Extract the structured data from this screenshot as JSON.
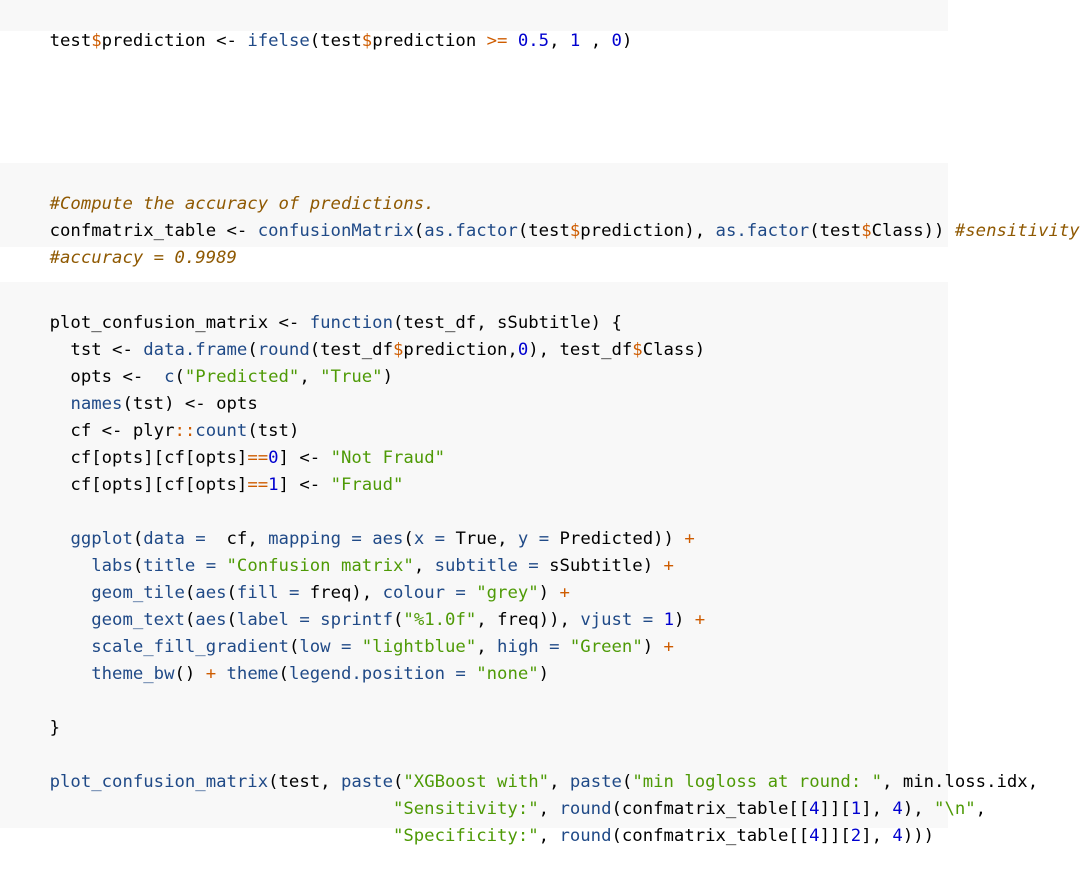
{
  "chunks": [
    {
      "lines": [
        [
          [
            "test",
            "default"
          ],
          [
            "$",
            "op"
          ],
          [
            "prediction <- ",
            "default"
          ],
          [
            "ifelse",
            "fn"
          ],
          [
            "(test",
            "default"
          ],
          [
            "$",
            "op"
          ],
          [
            "prediction ",
            "default"
          ],
          [
            ">=",
            "op"
          ],
          [
            " ",
            "default"
          ],
          [
            "0.5",
            "num"
          ],
          [
            ", ",
            "default"
          ],
          [
            "1",
            "num"
          ],
          [
            " , ",
            "default"
          ],
          [
            "0",
            "num"
          ],
          [
            ")",
            "default"
          ]
        ]
      ]
    },
    {
      "lines": [
        [
          [
            "#Compute the accuracy of predictions.",
            "comment"
          ]
        ],
        [
          [
            "confmatrix_table <- ",
            "default"
          ],
          [
            "confusionMatrix",
            "fn"
          ],
          [
            "(",
            "default"
          ],
          [
            "as.factor",
            "fn"
          ],
          [
            "(test",
            "default"
          ],
          [
            "$",
            "op"
          ],
          [
            "prediction), ",
            "default"
          ],
          [
            "as.factor",
            "fn"
          ],
          [
            "(test",
            "default"
          ],
          [
            "$",
            "op"
          ],
          [
            "Class)) ",
            "default"
          ],
          [
            "#sensitivity",
            "comment"
          ]
        ],
        [
          [
            "#accuracy = 0.9989",
            "comment"
          ]
        ]
      ]
    },
    {
      "lines": [
        [
          [
            "plot_confusion_matrix <- ",
            "default"
          ],
          [
            "function",
            "kw"
          ],
          [
            "(test_df, sSubtitle) {",
            "default"
          ]
        ],
        [
          [
            "  tst <- ",
            "default"
          ],
          [
            "data.frame",
            "fn"
          ],
          [
            "(",
            "default"
          ],
          [
            "round",
            "fn"
          ],
          [
            "(test_df",
            "default"
          ],
          [
            "$",
            "op"
          ],
          [
            "prediction,",
            "default"
          ],
          [
            "0",
            "num"
          ],
          [
            "), test_df",
            "default"
          ],
          [
            "$",
            "op"
          ],
          [
            "Class)",
            "default"
          ]
        ],
        [
          [
            "  opts <-  ",
            "default"
          ],
          [
            "c",
            "fn"
          ],
          [
            "(",
            "default"
          ],
          [
            "\"Predicted\"",
            "str"
          ],
          [
            ", ",
            "default"
          ],
          [
            "\"True\"",
            "str"
          ],
          [
            ")",
            "default"
          ]
        ],
        [
          [
            "  ",
            "default"
          ],
          [
            "names",
            "fn"
          ],
          [
            "(tst) <- opts",
            "default"
          ]
        ],
        [
          [
            "  cf <- plyr",
            "default"
          ],
          [
            "::",
            "op"
          ],
          [
            "count",
            "fn"
          ],
          [
            "(tst)",
            "default"
          ]
        ],
        [
          [
            "  cf[opts][cf[opts]",
            "default"
          ],
          [
            "==",
            "op"
          ],
          [
            "0",
            "num"
          ],
          [
            "] <- ",
            "default"
          ],
          [
            "\"Not Fraud\"",
            "str"
          ]
        ],
        [
          [
            "  cf[opts][cf[opts]",
            "default"
          ],
          [
            "==",
            "op"
          ],
          [
            "1",
            "num"
          ],
          [
            "] <- ",
            "default"
          ],
          [
            "\"Fraud\"",
            "str"
          ]
        ],
        [
          [
            "",
            "default"
          ]
        ],
        [
          [
            "  ",
            "default"
          ],
          [
            "ggplot",
            "fn"
          ],
          [
            "(",
            "default"
          ],
          [
            "data =",
            "fn"
          ],
          [
            "  cf, ",
            "default"
          ],
          [
            "mapping =",
            "fn"
          ],
          [
            " ",
            "default"
          ],
          [
            "aes",
            "fn"
          ],
          [
            "(",
            "default"
          ],
          [
            "x =",
            "fn"
          ],
          [
            " True, ",
            "default"
          ],
          [
            "y =",
            "fn"
          ],
          [
            " Predicted)) ",
            "default"
          ],
          [
            "+",
            "op"
          ]
        ],
        [
          [
            "    ",
            "default"
          ],
          [
            "labs",
            "fn"
          ],
          [
            "(",
            "default"
          ],
          [
            "title =",
            "fn"
          ],
          [
            " ",
            "default"
          ],
          [
            "\"Confusion matrix\"",
            "str"
          ],
          [
            ", ",
            "default"
          ],
          [
            "subtitle =",
            "fn"
          ],
          [
            " sSubtitle) ",
            "default"
          ],
          [
            "+",
            "op"
          ]
        ],
        [
          [
            "    ",
            "default"
          ],
          [
            "geom_tile",
            "fn"
          ],
          [
            "(",
            "default"
          ],
          [
            "aes",
            "fn"
          ],
          [
            "(",
            "default"
          ],
          [
            "fill =",
            "fn"
          ],
          [
            " freq), ",
            "default"
          ],
          [
            "colour =",
            "fn"
          ],
          [
            " ",
            "default"
          ],
          [
            "\"grey\"",
            "str"
          ],
          [
            ") ",
            "default"
          ],
          [
            "+",
            "op"
          ]
        ],
        [
          [
            "    ",
            "default"
          ],
          [
            "geom_text",
            "fn"
          ],
          [
            "(",
            "default"
          ],
          [
            "aes",
            "fn"
          ],
          [
            "(",
            "default"
          ],
          [
            "label =",
            "fn"
          ],
          [
            " ",
            "default"
          ],
          [
            "sprintf",
            "fn"
          ],
          [
            "(",
            "default"
          ],
          [
            "\"%1.0f\"",
            "str"
          ],
          [
            ", freq)), ",
            "default"
          ],
          [
            "vjust =",
            "fn"
          ],
          [
            " ",
            "default"
          ],
          [
            "1",
            "num"
          ],
          [
            ") ",
            "default"
          ],
          [
            "+",
            "op"
          ]
        ],
        [
          [
            "    ",
            "default"
          ],
          [
            "scale_fill_gradient",
            "fn"
          ],
          [
            "(",
            "default"
          ],
          [
            "low =",
            "fn"
          ],
          [
            " ",
            "default"
          ],
          [
            "\"lightblue\"",
            "str"
          ],
          [
            ", ",
            "default"
          ],
          [
            "high =",
            "fn"
          ],
          [
            " ",
            "default"
          ],
          [
            "\"Green\"",
            "str"
          ],
          [
            ") ",
            "default"
          ],
          [
            "+",
            "op"
          ]
        ],
        [
          [
            "    ",
            "default"
          ],
          [
            "theme_bw",
            "fn"
          ],
          [
            "() ",
            "default"
          ],
          [
            "+",
            "op"
          ],
          [
            " ",
            "default"
          ],
          [
            "theme",
            "fn"
          ],
          [
            "(",
            "default"
          ],
          [
            "legend.position =",
            "fn"
          ],
          [
            " ",
            "default"
          ],
          [
            "\"none\"",
            "str"
          ],
          [
            ")",
            "default"
          ]
        ],
        [
          [
            "",
            "default"
          ]
        ],
        [
          [
            "}",
            "default"
          ]
        ],
        [
          [
            "",
            "default"
          ]
        ],
        [
          [
            "plot_confusion_matrix",
            "default"
          ],
          [
            "(test, ",
            "default"
          ],
          [
            "paste",
            "fn"
          ],
          [
            "(",
            "default"
          ],
          [
            "\"XGBoost with\"",
            "str"
          ],
          [
            ", ",
            "default"
          ],
          [
            "paste",
            "fn"
          ],
          [
            "(",
            "default"
          ],
          [
            "\"min logloss at round: \"",
            "str"
          ],
          [
            ", min.loss.idx,",
            "default"
          ]
        ],
        [
          [
            "                                 ",
            "default"
          ],
          [
            "\"Sensitivity:\"",
            "str"
          ],
          [
            ", ",
            "default"
          ],
          [
            "round",
            "fn"
          ],
          [
            "(confmatrix_table[[",
            "default"
          ],
          [
            "4",
            "num"
          ],
          [
            "]][",
            "default"
          ],
          [
            "1",
            "num"
          ],
          [
            "], ",
            "default"
          ],
          [
            "4",
            "num"
          ],
          [
            "), ",
            "default"
          ],
          [
            "\"\\n\"",
            "str"
          ],
          [
            ",",
            "default"
          ]
        ],
        [
          [
            "                                 ",
            "default"
          ],
          [
            "\"Specificity:\"",
            "str"
          ],
          [
            ", ",
            "default"
          ],
          [
            "round",
            "fn"
          ],
          [
            "(confmatrix_table[[",
            "default"
          ],
          [
            "4",
            "num"
          ],
          [
            "]][",
            "default"
          ],
          [
            "2",
            "num"
          ],
          [
            "], ",
            "default"
          ],
          [
            "4",
            "num"
          ],
          [
            ")))",
            "default"
          ]
        ]
      ]
    }
  ]
}
